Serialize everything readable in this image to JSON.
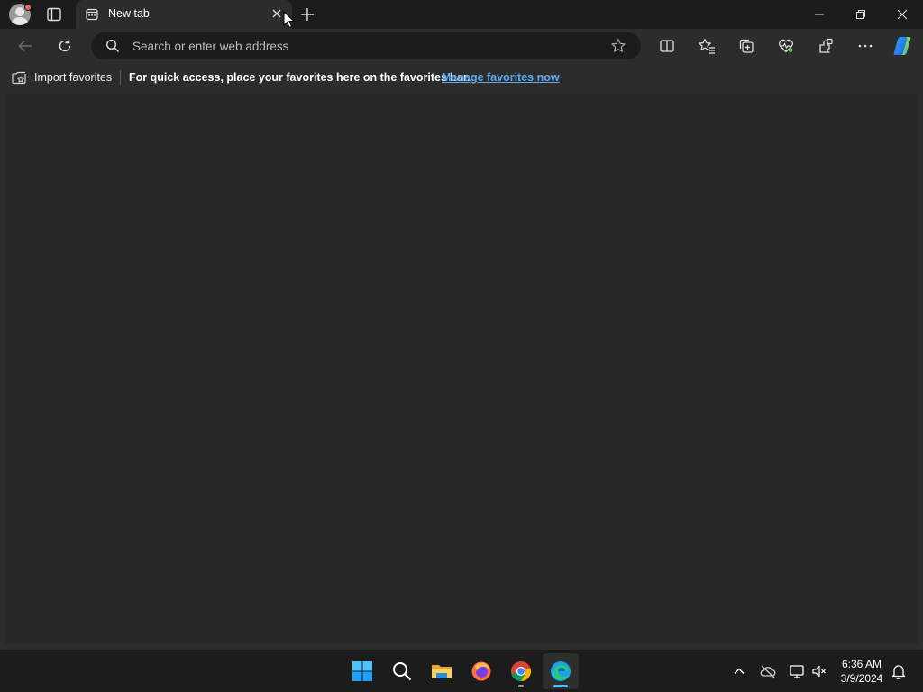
{
  "browser": {
    "tab": {
      "title": "New tab"
    },
    "address_bar": {
      "placeholder": "Search or enter web address",
      "value": ""
    },
    "favorites_bar": {
      "import_label": "Import favorites",
      "message": "For quick access, place your favorites here on the favorites bar.",
      "manage_link": "Manage favorites now"
    },
    "toolbar_icons": [
      "back-icon",
      "refresh-icon",
      "search-icon",
      "star-icon",
      "split-screen-icon",
      "favorites-icon",
      "collections-icon",
      "browser-essentials-icon",
      "extensions-icon",
      "more-icon",
      "copilot-icon"
    ],
    "window_controls": [
      "minimize-icon",
      "restore-icon",
      "close-icon"
    ]
  },
  "taskbar": {
    "apps": [
      "windows-start",
      "search",
      "file-explorer",
      "firefox",
      "chrome",
      "edge"
    ],
    "clock": {
      "time": "6:36 AM",
      "date": "3/9/2024"
    },
    "tray_icons": [
      "chevron-up-icon",
      "onedrive-icon",
      "network-icon",
      "volume-muted-icon",
      "notifications-icon"
    ]
  },
  "colors": {
    "accent": "#4cc2ff",
    "link": "#5fa8ef",
    "chrome_bg": "#2c2c2c",
    "page_bg": "#272727"
  }
}
